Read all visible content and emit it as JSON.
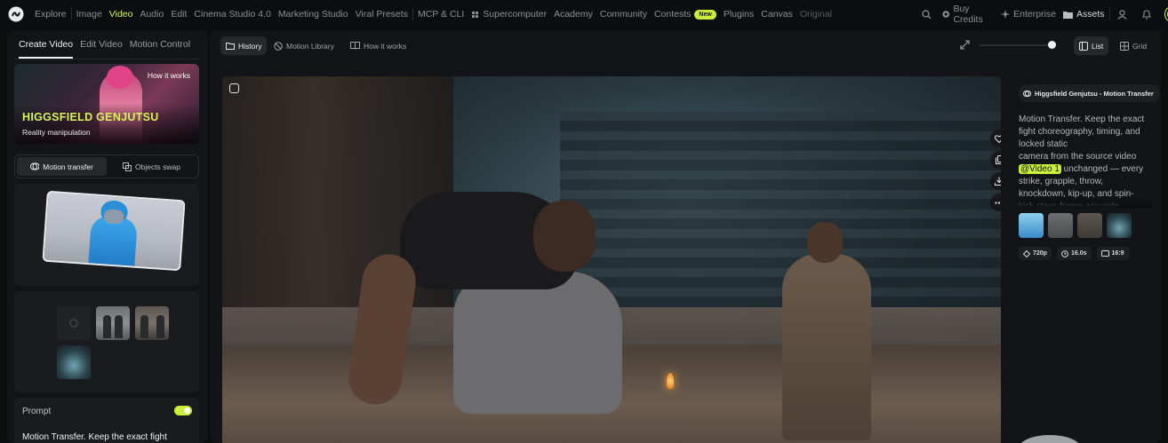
{
  "nav": {
    "items": [
      {
        "label": "Explore"
      },
      {
        "label": "Image"
      },
      {
        "label": "Video"
      },
      {
        "label": "Audio"
      },
      {
        "label": "Edit"
      },
      {
        "label": "Cinema Studio 4.0"
      },
      {
        "label": "Marketing Studio"
      },
      {
        "label": "Viral Presets"
      },
      {
        "label": "MCP & CLI"
      },
      {
        "label": "Supercomputer",
        "icon": "supercomputer-icon"
      },
      {
        "label": "Academy"
      },
      {
        "label": "Community"
      },
      {
        "label": "Contests",
        "badge": "New"
      },
      {
        "label": "Plugins"
      },
      {
        "label": "Canvas"
      },
      {
        "label": "Original"
      }
    ],
    "active": "Video",
    "buy_credits": "Buy Credits",
    "enterprise": "Enterprise",
    "assets": "Assets"
  },
  "left": {
    "tabs": [
      "Create Video",
      "Edit Video",
      "Motion Control"
    ],
    "hero": {
      "how_it_works": "How it works",
      "title": "HIGGSFIELD GENJUTSU",
      "subtitle": "Reality manipulation"
    },
    "modes": [
      "Motion transfer",
      "Objects swap"
    ],
    "prompt_label": "Prompt",
    "prompt_text": "Motion Transfer. Keep the exact fight"
  },
  "toolbar": {
    "history": "History",
    "motion_library": "Motion Library",
    "how_it_works": "How it works",
    "list": "List",
    "grid": "Grid"
  },
  "info": {
    "chip": "Higgsfield Genjutsu - Motion Transfer",
    "desc_lines": [
      "Motion Transfer. Keep the exact",
      "fight choreography, timing, and",
      "locked static",
      "camera from the source video",
      "unchanged — every",
      "strike, grapple, throw,",
      "knockdown, kip-up, and spin-",
      "kick stays frame-accurate"
    ],
    "video_tag": "@Video 1",
    "meta": {
      "resolution": "720p",
      "duration": "16.0s",
      "ratio": "16:9"
    }
  },
  "colors": {
    "accent": "#c9ef3a",
    "background": "#0c0d0f",
    "panel": "#131417"
  }
}
